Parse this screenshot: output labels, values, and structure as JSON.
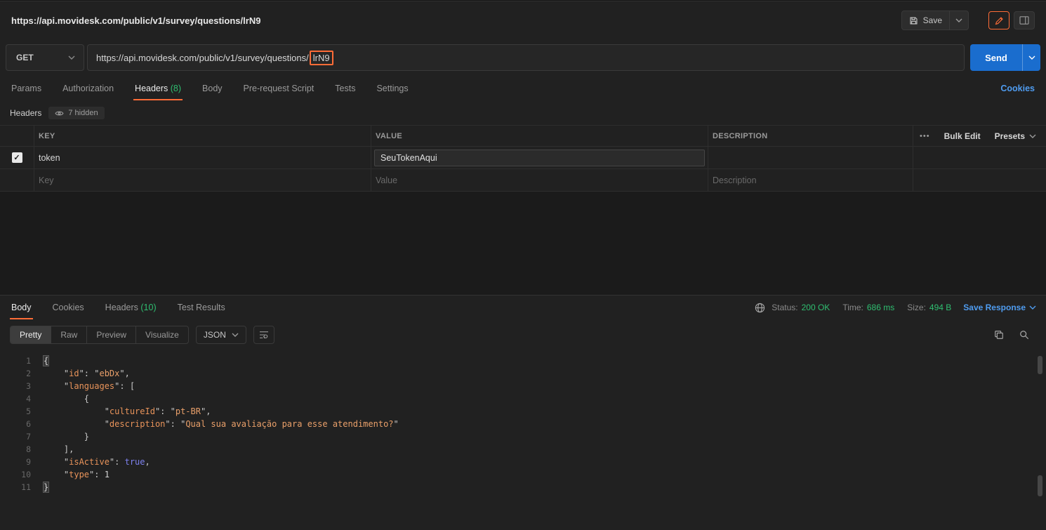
{
  "topbar": {
    "title": "https://api.movidesk.com/public/v1/survey/questions/lrN9",
    "save_label": "Save"
  },
  "request": {
    "method": "GET",
    "url_prefix": "https://api.movidesk.com/public/v1/survey/questions/",
    "url_highlight": "lrN9",
    "send_label": "Send"
  },
  "request_tabs": {
    "items": [
      {
        "label": "Params"
      },
      {
        "label": "Authorization"
      },
      {
        "label": "Headers",
        "count": "(8)",
        "active": true
      },
      {
        "label": "Body"
      },
      {
        "label": "Pre-request Script"
      },
      {
        "label": "Tests"
      },
      {
        "label": "Settings"
      }
    ],
    "cookies_label": "Cookies"
  },
  "headers_panel": {
    "title": "Headers",
    "hidden_badge": "7 hidden"
  },
  "headers_table": {
    "columns": [
      "KEY",
      "VALUE",
      "DESCRIPTION"
    ],
    "more_icon": "•••",
    "bulk_edit_label": "Bulk Edit",
    "presets_label": "Presets",
    "row": {
      "key": "token",
      "value": "SeuTokenAqui",
      "description": ""
    },
    "placeholder": {
      "key": "Key",
      "value": "Value",
      "description": "Description"
    }
  },
  "response": {
    "tabs": [
      {
        "label": "Body",
        "active": true
      },
      {
        "label": "Cookies"
      },
      {
        "label": "Headers",
        "count": "(10)"
      },
      {
        "label": "Test Results"
      }
    ],
    "status_label": "Status:",
    "status_value": "200 OK",
    "time_label": "Time:",
    "time_value": "686 ms",
    "size_label": "Size:",
    "size_value": "494 B",
    "save_response_label": "Save Response",
    "view_tabs": [
      {
        "label": "Pretty",
        "active": true
      },
      {
        "label": "Raw"
      },
      {
        "label": "Preview"
      },
      {
        "label": "Visualize"
      }
    ],
    "format_label": "JSON"
  },
  "code": {
    "lines": [
      [
        [
          "hlb",
          "{"
        ]
      ],
      [
        [
          "pun",
          "    \""
        ],
        [
          "key",
          "id"
        ],
        [
          "pun",
          "\": \""
        ],
        [
          "str",
          "ebDx"
        ],
        [
          "pun",
          "\","
        ]
      ],
      [
        [
          "pun",
          "    \""
        ],
        [
          "key",
          "languages"
        ],
        [
          "pun",
          "\": ["
        ]
      ],
      [
        [
          "pun",
          "        {"
        ]
      ],
      [
        [
          "pun",
          "            \""
        ],
        [
          "key",
          "cultureId"
        ],
        [
          "pun",
          "\": \""
        ],
        [
          "str",
          "pt-BR"
        ],
        [
          "pun",
          "\","
        ]
      ],
      [
        [
          "pun",
          "            \""
        ],
        [
          "key",
          "description"
        ],
        [
          "pun",
          "\": \""
        ],
        [
          "str",
          "Qual sua avaliação para esse atendimento?"
        ],
        [
          "pun",
          "\""
        ]
      ],
      [
        [
          "pun",
          "        }"
        ]
      ],
      [
        [
          "pun",
          "    ],"
        ]
      ],
      [
        [
          "pun",
          "    \""
        ],
        [
          "key",
          "isActive"
        ],
        [
          "pun",
          "\": "
        ],
        [
          "boo",
          "true"
        ],
        [
          "pun",
          ","
        ]
      ],
      [
        [
          "pun",
          "    \""
        ],
        [
          "key",
          "type"
        ],
        [
          "pun",
          "\": "
        ],
        [
          "num",
          "1"
        ]
      ],
      [
        [
          "hlb",
          "}"
        ]
      ]
    ]
  },
  "colors": {
    "accent_orange": "#ff6c37",
    "success_green": "#2fbf71",
    "link_blue": "#4f9cf0",
    "send_blue": "#1a6dce"
  }
}
